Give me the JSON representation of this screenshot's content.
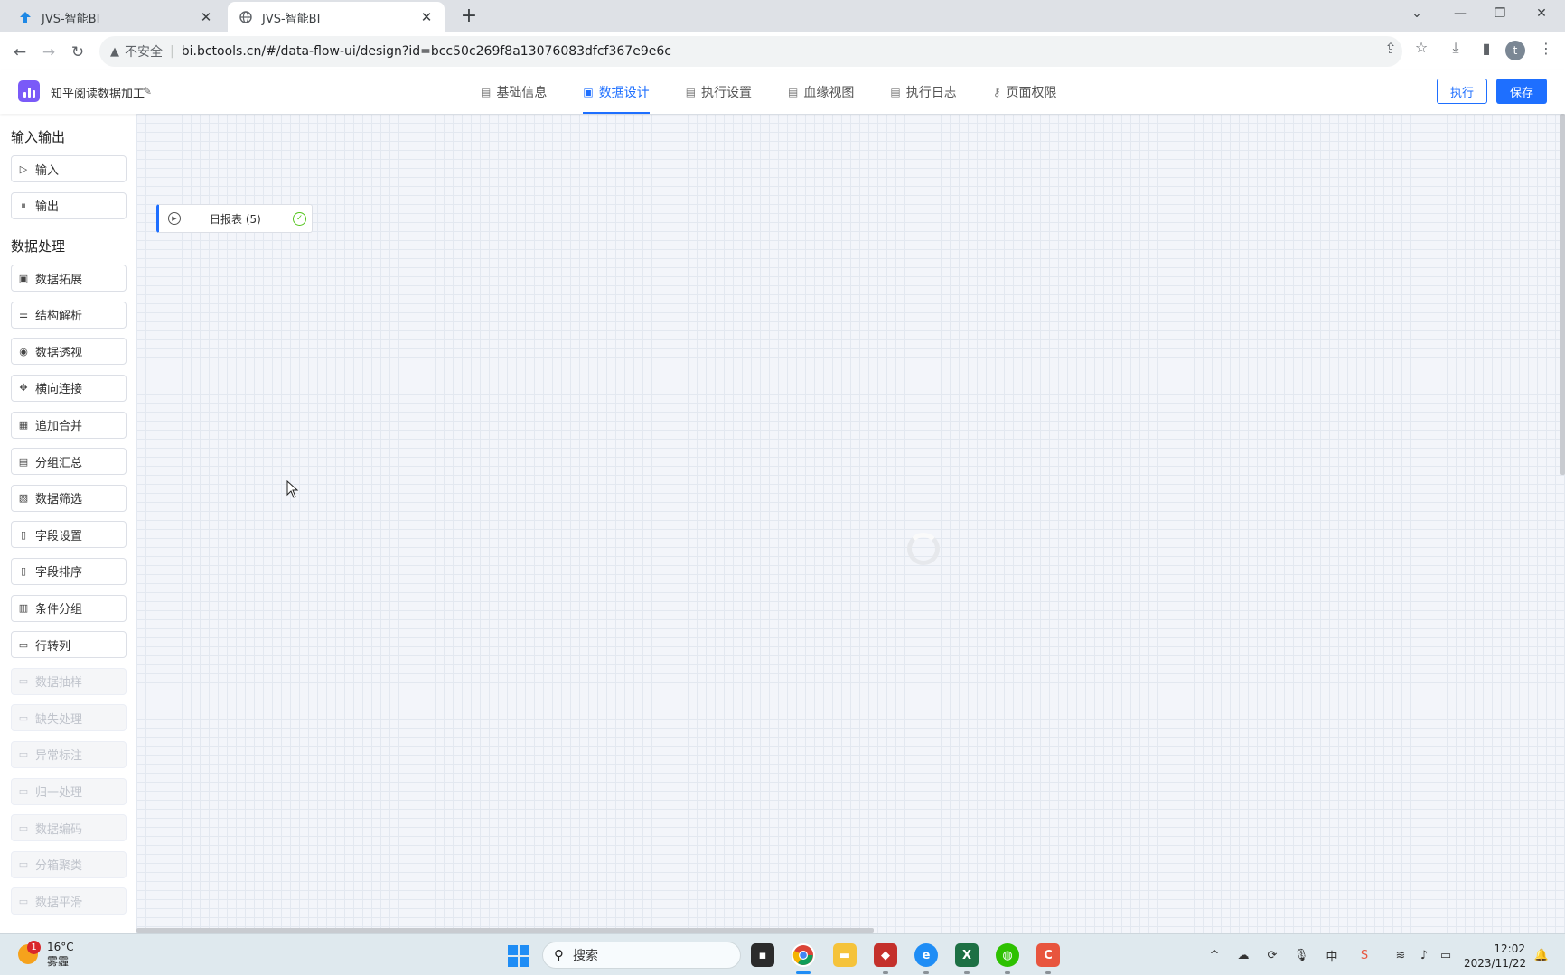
{
  "browser": {
    "tabs": [
      {
        "title": "JVS-智能BI",
        "favicon": "jvs-logo-icon",
        "close": "✕"
      },
      {
        "title": "JVS-智能BI",
        "favicon": "globe-icon",
        "close": "✕"
      }
    ],
    "new_tab": "+",
    "security_label": "不安全",
    "separator": "|",
    "url": "bi.bctools.cn/#/data-flow-ui/design?id=bcc50c269f8a13076083dfcf367e9e6c",
    "profile_initial": "t"
  },
  "app": {
    "title": "知乎阅读数据加工",
    "nav_tabs": [
      {
        "label": "基础信息",
        "icon": "doc-icon"
      },
      {
        "label": "数据设计",
        "icon": "design-icon",
        "active": true
      },
      {
        "label": "执行设置",
        "icon": "doc-icon"
      },
      {
        "label": "血缘视图",
        "icon": "doc-icon"
      },
      {
        "label": "执行日志",
        "icon": "doc-icon"
      },
      {
        "label": "页面权限",
        "icon": "key-icon"
      }
    ],
    "run_label": "执行",
    "save_label": "保存",
    "accent": "#1e6fff"
  },
  "sidebar": {
    "io_title": "输入输出",
    "io_items": [
      {
        "label": "输入",
        "icon": "play-circle-icon"
      },
      {
        "label": "输出",
        "icon": "pause-circle-icon"
      }
    ],
    "proc_title": "数据处理",
    "proc_items": [
      {
        "label": "数据拓展",
        "icon": "copy-icon",
        "enabled": true
      },
      {
        "label": "结构解析",
        "icon": "sliders-icon",
        "enabled": true
      },
      {
        "label": "数据透视",
        "icon": "eye-icon",
        "enabled": true
      },
      {
        "label": "横向连接",
        "icon": "move-icon",
        "enabled": true
      },
      {
        "label": "追加合并",
        "icon": "calendar-icon",
        "enabled": true
      },
      {
        "label": "分组汇总",
        "icon": "list-doc-icon",
        "enabled": true
      },
      {
        "label": "数据筛选",
        "icon": "filter-doc-icon",
        "enabled": true
      },
      {
        "label": "字段设置",
        "icon": "doc-icon",
        "enabled": true
      },
      {
        "label": "字段排序",
        "icon": "doc-icon",
        "enabled": true
      },
      {
        "label": "条件分组",
        "icon": "grid-icon",
        "enabled": true
      },
      {
        "label": "行转列",
        "icon": "box-icon",
        "enabled": true
      },
      {
        "label": "数据抽样",
        "icon": "box-icon",
        "enabled": false
      },
      {
        "label": "缺失处理",
        "icon": "box-icon",
        "enabled": false
      },
      {
        "label": "异常标注",
        "icon": "box-icon",
        "enabled": false
      },
      {
        "label": "归一处理",
        "icon": "box-icon",
        "enabled": false
      },
      {
        "label": "数据编码",
        "icon": "box-icon",
        "enabled": false
      },
      {
        "label": "分箱聚类",
        "icon": "box-icon",
        "enabled": false
      },
      {
        "label": "数据平滑",
        "icon": "box-icon",
        "enabled": false
      }
    ]
  },
  "canvas": {
    "node": {
      "label": "日报表 (5)",
      "status": "success"
    }
  },
  "taskbar": {
    "weather_badge": "1",
    "temperature": "16°C",
    "weather": "雾霾",
    "search_placeholder": "搜索",
    "ime": "中",
    "time": "12:02",
    "date": "2023/11/22"
  }
}
